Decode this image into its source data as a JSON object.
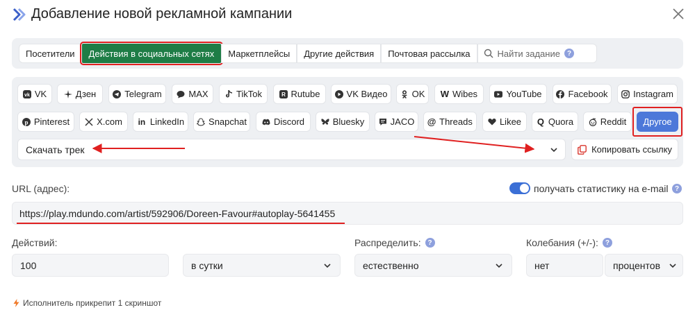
{
  "header": {
    "title": "Добавление новой рекламной кампании",
    "logo_icon": "double-chevron-right-icon",
    "close_icon": "close-icon"
  },
  "category_tabs": {
    "items": [
      {
        "label": "Посетители",
        "active": false
      },
      {
        "label": "Действия в социальных сетях",
        "active": true
      },
      {
        "label": "Маркетплейсы",
        "active": false
      },
      {
        "label": "Другие действия",
        "active": false
      },
      {
        "label": "Почтовая рассылка",
        "active": false
      }
    ],
    "search_placeholder": "Найти задание",
    "help": "?"
  },
  "social_networks": {
    "row1": [
      {
        "label": "VK",
        "icon": "vk-icon"
      },
      {
        "label": "Дзен",
        "icon": "dzen-icon"
      },
      {
        "label": "Telegram",
        "icon": "telegram-icon"
      },
      {
        "label": "MAX",
        "icon": "max-chat-icon"
      },
      {
        "label": "TikTok",
        "icon": "tiktok-icon"
      },
      {
        "label": "Rutube",
        "icon": "rutube-icon"
      },
      {
        "label": "VK Видео",
        "icon": "vk-video-play-icon"
      },
      {
        "label": "OK",
        "icon": "ok-icon"
      },
      {
        "label": "Wibes",
        "icon": "wibes-icon"
      },
      {
        "label": "YouTube",
        "icon": "youtube-icon"
      },
      {
        "label": "Facebook",
        "icon": "facebook-icon"
      },
      {
        "label": "Instagram",
        "icon": "instagram-icon"
      }
    ],
    "row2": [
      {
        "label": "Pinterest",
        "icon": "pinterest-icon"
      },
      {
        "label": "X.com",
        "icon": "x-icon"
      },
      {
        "label": "LinkedIn",
        "icon": "linkedin-icon"
      },
      {
        "label": "Snapchat",
        "icon": "snapchat-icon"
      },
      {
        "label": "Discord",
        "icon": "discord-icon"
      },
      {
        "label": "Bluesky",
        "icon": "bluesky-icon"
      },
      {
        "label": "JACO",
        "icon": "jaco-icon"
      },
      {
        "label": "Threads",
        "icon": "threads-icon"
      },
      {
        "label": "Likee",
        "icon": "heart-icon"
      },
      {
        "label": "Quora",
        "icon": "quora-icon"
      },
      {
        "label": "Reddit",
        "icon": "reddit-icon"
      },
      {
        "label": "Другое",
        "icon": "",
        "selected": true
      }
    ],
    "action_select_value": "Скачать трек",
    "copy_link_label": "Копировать ссылку"
  },
  "url": {
    "label": "URL (адрес):",
    "value": "https://play.mdundo.com/artist/592906/Doreen-Favour#autoplay-5641455",
    "email_stats_label": "получать статистику на e-mail",
    "email_stats_enabled": true
  },
  "settings": {
    "actions_label": "Действий:",
    "actions_value": "100",
    "period_value": "в сутки",
    "distribute_label": "Распределить:",
    "distribute_value": "естественно",
    "fluctuation_label": "Колебания (+/-):",
    "fluctuation_value": "нет",
    "fluctuation_unit": "процентов"
  },
  "note": {
    "text": "Исполнитель прикрепит 1 скриншот",
    "icon": "lightning-icon"
  },
  "colors": {
    "active_tab": "#1e7d46",
    "selected_chip": "#4c78d9",
    "annotation_red": "#e02020",
    "toggle_on": "#3b6fd6"
  }
}
